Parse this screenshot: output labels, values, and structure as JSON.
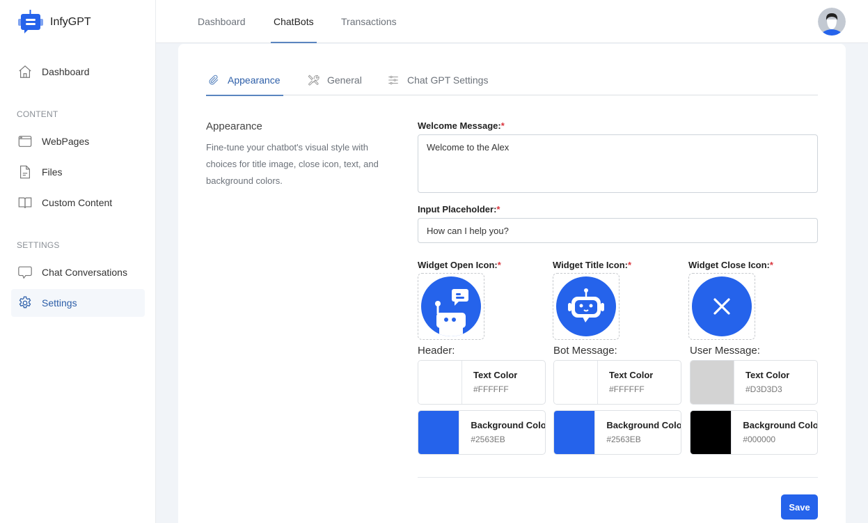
{
  "app": {
    "name": "InfyGPT"
  },
  "sidebar": {
    "dashboard": {
      "label": "Dashboard",
      "icon": "home-icon"
    },
    "sections": [
      {
        "title": "CONTENT",
        "items": [
          {
            "label": "WebPages",
            "icon": "browser-window-icon"
          },
          {
            "label": "Files",
            "icon": "file-icon"
          },
          {
            "label": "Custom Content",
            "icon": "book-icon"
          }
        ]
      },
      {
        "title": "SETTINGS",
        "items": [
          {
            "label": "Chat Conversations",
            "icon": "chat-bubble-icon"
          },
          {
            "label": "Settings",
            "icon": "gear-icon",
            "active": true
          }
        ]
      }
    ]
  },
  "topbar": {
    "tabs": [
      {
        "label": "Dashboard"
      },
      {
        "label": "ChatBots",
        "active": true
      },
      {
        "label": "Transactions"
      }
    ],
    "avatar": "user-avatar-icon"
  },
  "settings_tabs": [
    {
      "label": "Appearance",
      "icon": "paperclip-icon",
      "active": true
    },
    {
      "label": "General",
      "icon": "tools-icon"
    },
    {
      "label": "Chat GPT Settings",
      "icon": "sliders-icon"
    }
  ],
  "appearance": {
    "title": "Appearance",
    "description": "Fine-tune your chatbot's visual style with choices for title image, close icon, text, and background colors."
  },
  "form": {
    "welcome_message": {
      "label": "Welcome Message:",
      "required": "*",
      "value": "Welcome to the Alex"
    },
    "input_placeholder": {
      "label": "Input Placeholder:",
      "required": "*",
      "value": "How can I help you?"
    },
    "widget_icons": [
      {
        "label": "Widget Open Icon:",
        "required": "*",
        "icon": "chatbot-open-icon"
      },
      {
        "label": "Widget Title Icon:",
        "required": "*",
        "icon": "robot-head-icon"
      },
      {
        "label": "Widget Close Icon:",
        "required": "*",
        "icon": "close-icon"
      }
    ],
    "color_groups": [
      {
        "title": "Header:",
        "text_color": {
          "label": "Text Color",
          "value": "#FFFFFF"
        },
        "background_color": {
          "label": "Background Color",
          "value": "#2563EB"
        }
      },
      {
        "title": "Bot Message:",
        "text_color": {
          "label": "Text Color",
          "value": "#FFFFFF"
        },
        "background_color": {
          "label": "Background Color",
          "value": "#2563EB"
        }
      },
      {
        "title": "User Message:",
        "text_color": {
          "label": "Text Color",
          "value": "#D3D3D3"
        },
        "background_color": {
          "label": "Background Color",
          "value": "#000000"
        }
      }
    ],
    "save_label": "Save"
  },
  "colors": {
    "accent": "#2563eb",
    "active_nav": "#2c5ea8",
    "required": "#d9363e"
  }
}
